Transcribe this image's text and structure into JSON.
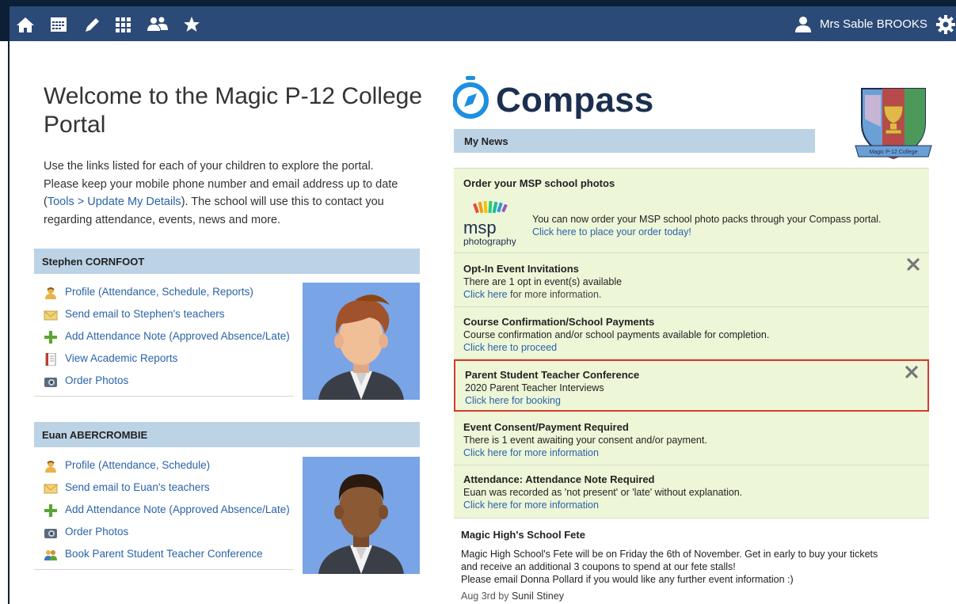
{
  "topbar": {
    "nav_icons": [
      "home-icon",
      "calendar-icon",
      "pencil-icon",
      "grid-icon",
      "people-icon",
      "star-icon"
    ],
    "user_name": "Mrs Sable BROOKS",
    "colors": {
      "bar": "#2b4a77",
      "frame": "#0b1f36"
    }
  },
  "welcome": {
    "title": "Welcome to the Magic P-12 College Portal",
    "text_before": "Use the links listed for each of your children to explore the portal. Please keep your mobile phone number and email address up to date (",
    "link": "Tools > Update My Details",
    "text_after": "). The school will use this to contact you regarding attendance, events, news and more."
  },
  "children": [
    {
      "name": "Stephen CORNFOOT",
      "links": [
        {
          "icon": "profile-icon",
          "label": "Profile (Attendance, Schedule, Reports)"
        },
        {
          "icon": "email-icon",
          "label": "Send email to Stephen's teachers"
        },
        {
          "icon": "plus-icon",
          "label": "Add Attendance Note (Approved Absence/Late)"
        },
        {
          "icon": "report-icon",
          "label": "View Academic Reports"
        },
        {
          "icon": "camera-icon",
          "label": "Order Photos"
        }
      ]
    },
    {
      "name": "Euan ABERCROMBIE",
      "links": [
        {
          "icon": "profile-icon",
          "label": "Profile (Attendance, Schedule)"
        },
        {
          "icon": "email-icon",
          "label": "Send email to Euan's teachers"
        },
        {
          "icon": "plus-icon",
          "label": "Add Attendance Note (Approved Absence/Late)"
        },
        {
          "icon": "camera-icon",
          "label": "Order Photos"
        },
        {
          "icon": "conference-icon",
          "label": "Book Parent Student Teacher Conference"
        }
      ]
    }
  ],
  "brand": {
    "name": "Compass",
    "crest_text": "Magic P-12 College",
    "color": "#1c2f4f",
    "accent": "#1e8fe0"
  },
  "news": {
    "header": "My News",
    "items": [
      {
        "title": "Order your MSP school photos",
        "msp_brand": "msp",
        "msp_sub": "photography",
        "body": "You can now order your MSP school photo packs through your Compass portal.",
        "link": "Click here to place your order today!"
      },
      {
        "title": "Opt-In Event Invitations",
        "body": "There are 1 opt in event(s) available",
        "link": "Click here",
        "link_rest": " for more information."
      },
      {
        "title": "Course Confirmation/School Payments",
        "body": "Course confirmation and/or school payments available for completion.",
        "link": "Click here to proceed"
      },
      {
        "title": "Parent Student Teacher Conference",
        "body": "2020 Parent Teacher Interviews",
        "link": "Click here for booking"
      },
      {
        "title": "Event Consent/Payment Required",
        "body": "There is 1 event awaiting your consent and/or payment.",
        "link": "Click here for more information"
      },
      {
        "title": "Attendance: Attendance Note Required",
        "body": "Euan was recorded as 'not present' or 'late' without explanation.",
        "link": "Click here for more information"
      }
    ],
    "fete": {
      "title": "Magic High's School Fete",
      "body_lines": [
        "Magic High School's Fete will be on Friday the 6th of November. Get in early to buy your tickets",
        "and receive an additional 3 coupons to spend at our fete stalls!",
        "Please email Donna Pollard if you would like any further event information :)"
      ],
      "date": "Aug 3rd by ",
      "author": "Sunil Stiney"
    }
  }
}
